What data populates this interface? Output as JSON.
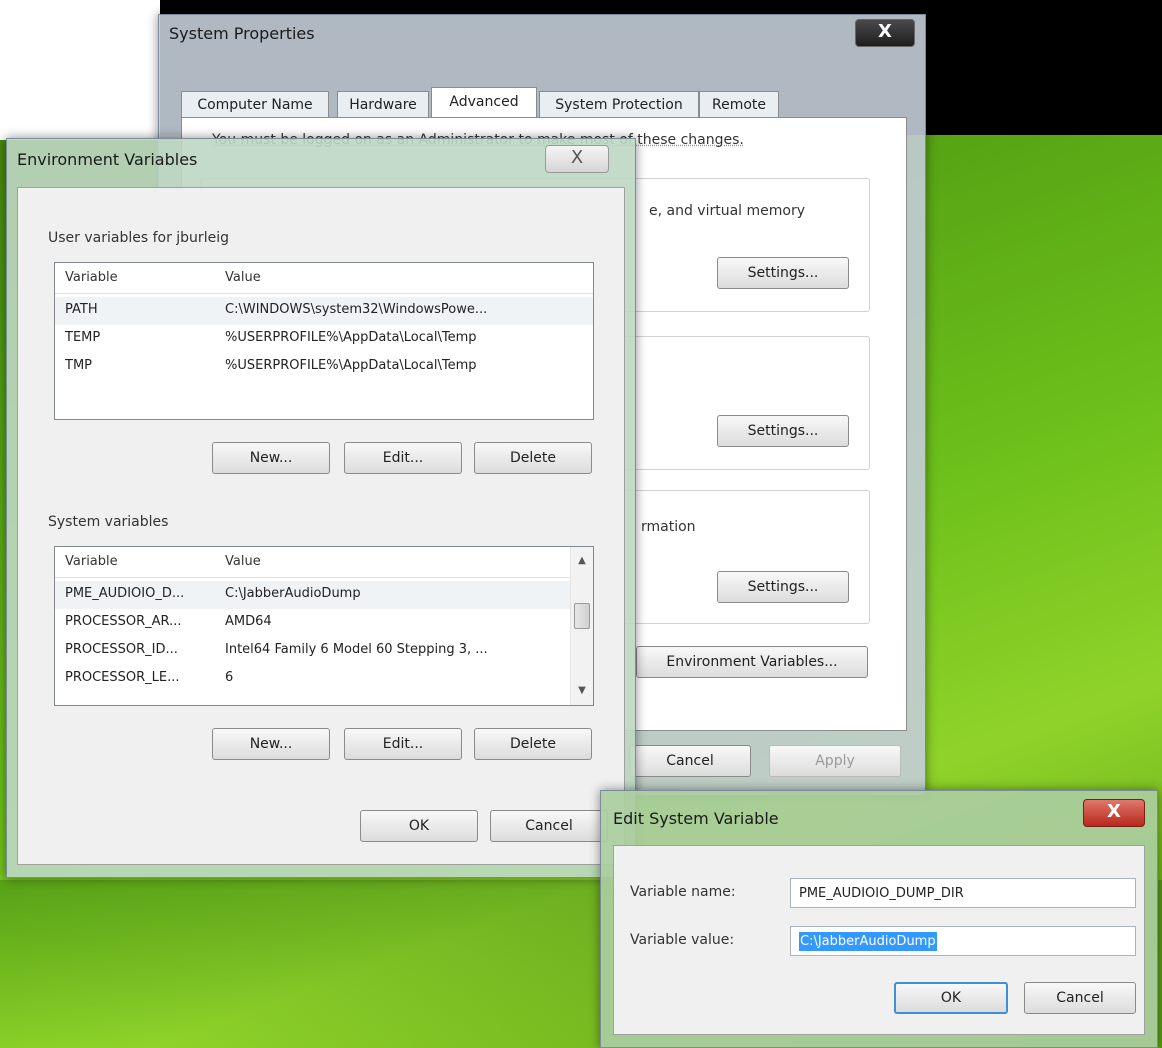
{
  "system_properties": {
    "title": "System Properties",
    "close": "X",
    "tabs": [
      "Computer Name",
      "Hardware",
      "Advanced",
      "System Protection",
      "Remote"
    ],
    "admin_note": "You must be logged on as an Administrator to make most of these changes.",
    "performance_fragment": "e, and virtual memory",
    "startup_fragment": "rmation",
    "settings_label": "Settings...",
    "env_button": "Environment Variables...",
    "cancel": "Cancel",
    "apply": "Apply"
  },
  "env_vars": {
    "title": "Environment Variables",
    "close": "X",
    "user_section": "User variables for jburleig",
    "columns": [
      "Variable",
      "Value"
    ],
    "user_rows": [
      {
        "variable": "PATH",
        "value": "C:\\WINDOWS\\system32\\WindowsPowe..."
      },
      {
        "variable": "TEMP",
        "value": "%USERPROFILE%\\AppData\\Local\\Temp"
      },
      {
        "variable": "TMP",
        "value": "%USERPROFILE%\\AppData\\Local\\Temp"
      }
    ],
    "system_section": "System variables",
    "system_rows": [
      {
        "variable": "PME_AUDIOIO_D...",
        "value": "C:\\JabberAudioDump"
      },
      {
        "variable": "PROCESSOR_AR...",
        "value": "AMD64"
      },
      {
        "variable": "PROCESSOR_ID...",
        "value": "Intel64 Family 6 Model 60 Stepping 3, ..."
      },
      {
        "variable": "PROCESSOR_LE...",
        "value": "6"
      }
    ],
    "new": "New...",
    "edit": "Edit...",
    "delete": "Delete",
    "ok": "OK",
    "cancel": "Cancel"
  },
  "edit_var": {
    "title": "Edit System Variable",
    "close": "X",
    "name_label": "Variable name:",
    "name_value": "PME_AUDIOIO_DUMP_DIR",
    "value_label": "Variable value:",
    "value_value": "C:\\JabberAudioDump",
    "ok": "OK",
    "cancel": "Cancel"
  },
  "colors": {
    "close_red": "#c9372c",
    "selection_blue": "#3399ff"
  }
}
